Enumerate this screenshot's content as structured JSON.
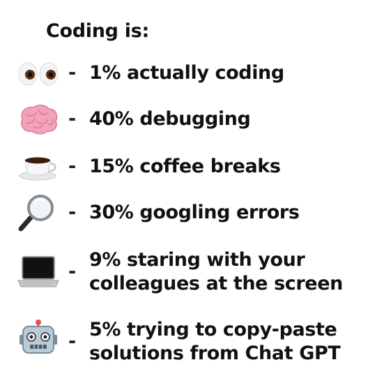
{
  "title": "Coding is:",
  "items": [
    {
      "icon": "eyes-icon",
      "dash": "-",
      "lines": [
        "1% actually coding"
      ]
    },
    {
      "icon": "brain-icon",
      "dash": "-",
      "lines": [
        "40% debugging"
      ]
    },
    {
      "icon": "coffee-icon",
      "dash": "-",
      "lines": [
        "15% coffee breaks"
      ]
    },
    {
      "icon": "magnifying-glass-icon",
      "dash": "-",
      "lines": [
        "30% googling errors"
      ]
    },
    {
      "icon": "laptop-icon",
      "dash": "-",
      "lines": [
        "9% staring with your",
        "colleagues at the screen"
      ]
    },
    {
      "icon": "robot-icon",
      "dash": "-",
      "lines": [
        "5% trying to copy-paste",
        "solutions from Chat GPT"
      ]
    }
  ]
}
